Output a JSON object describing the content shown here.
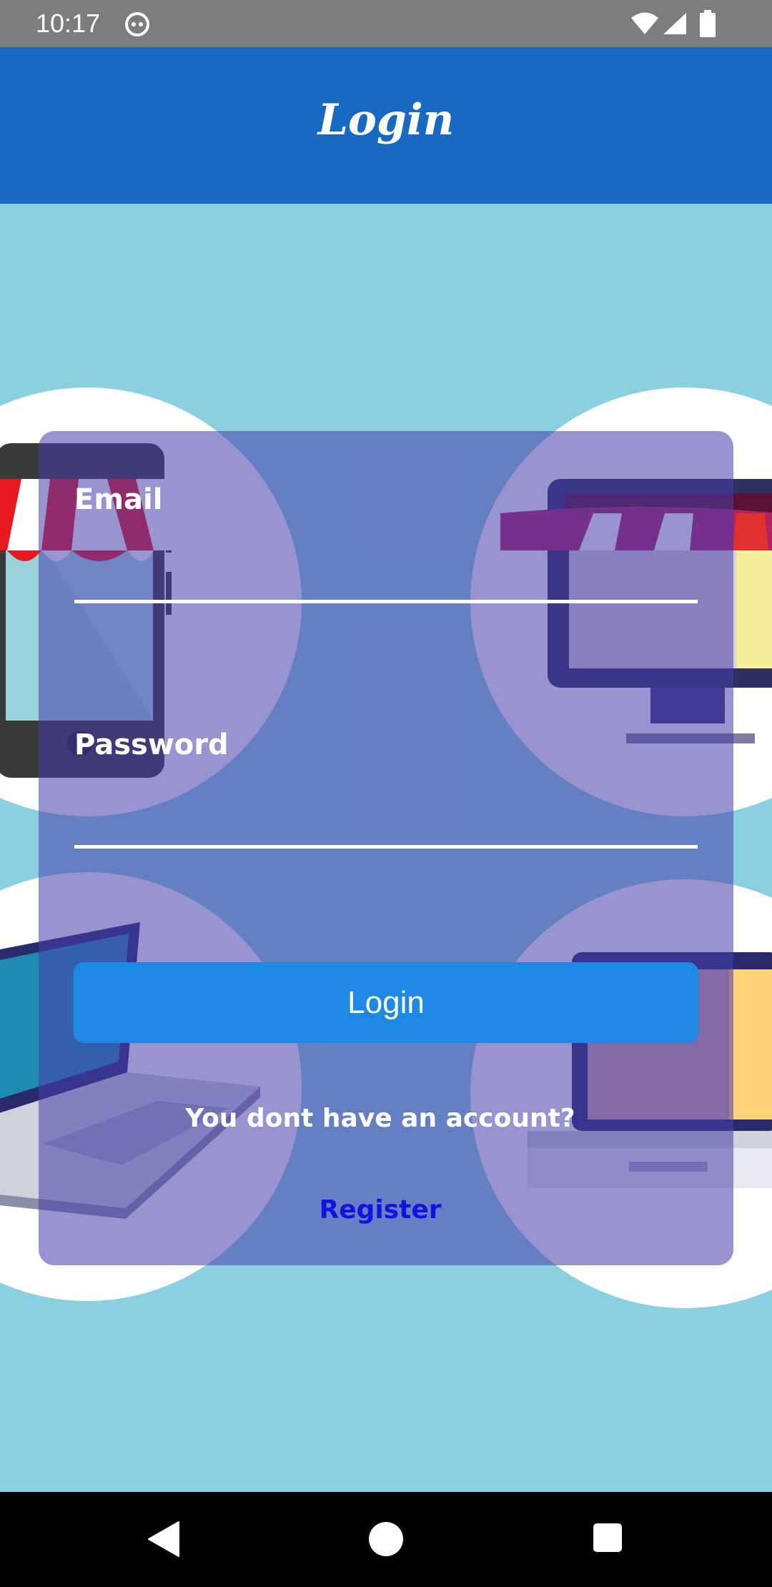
{
  "status_bar": {
    "time": "10:17",
    "icons": [
      "android-debug-icon",
      "wifi-icon",
      "cell-signal-icon",
      "battery-icon"
    ]
  },
  "app_bar": {
    "title": "Login",
    "color": "#1869c2"
  },
  "form": {
    "email_label": "Email",
    "email_value": "",
    "password_label": "Password",
    "password_value": "",
    "login_button": "Login",
    "no_account_text": "You dont have an account?",
    "register_link": "Register"
  },
  "colors": {
    "background": "#8ad0e0",
    "card": "rgba(70,60,170,0.55)",
    "button": "#1e88e5",
    "register_link": "#1412e0"
  },
  "nav_bar": {
    "icons": [
      "back-icon",
      "home-icon",
      "recents-icon"
    ]
  }
}
